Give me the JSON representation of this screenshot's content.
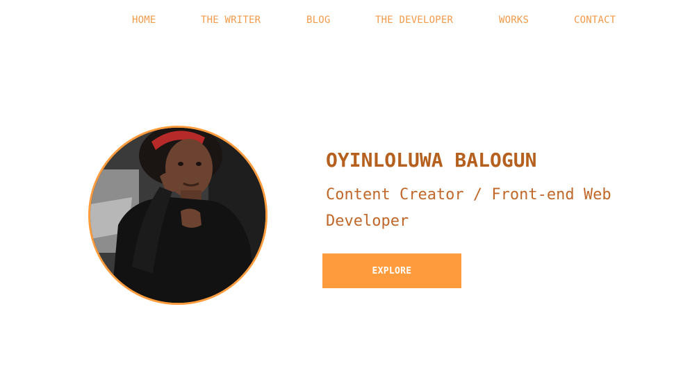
{
  "colors": {
    "nav_text": "#f39a4a",
    "accent": "#fe9b3c",
    "heading": "#b5601e",
    "tagline": "#c0672a",
    "button_text": "#ffffff"
  },
  "nav": {
    "items": [
      {
        "label": "HOME"
      },
      {
        "label": "THE WRITER"
      },
      {
        "label": "BLOG"
      },
      {
        "label": "THE DEVELOPER"
      },
      {
        "label": "WORKS"
      },
      {
        "label": "CONTACT"
      }
    ]
  },
  "hero": {
    "name": "OYINLOLUWA BALOGUN",
    "tagline": "Content Creator / Front-end Web Developer",
    "button_label": "EXPLORE",
    "photo_icon": "profile-photo"
  }
}
